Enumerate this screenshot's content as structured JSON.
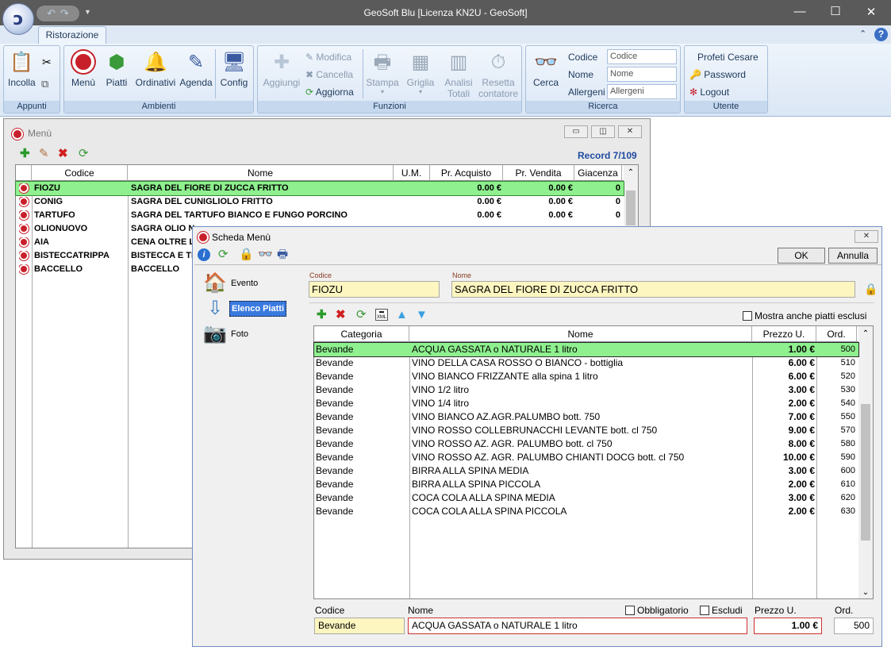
{
  "app": {
    "title": "GeoSoft Blu   [Licenza KN2U - GeoSoft]",
    "orb_letter": "ɔ"
  },
  "ribbon": {
    "tab": "Ristorazione",
    "groups": {
      "appunti": "Appunti",
      "ambienti": "Ambienti",
      "funzioni": "Funzioni",
      "ricerca": "Ricerca",
      "utente": "Utente"
    },
    "buttons": {
      "incolla": "Incolla",
      "menu": "Menù",
      "piatti": "Piatti",
      "ordinativi": "Ordinativi",
      "agenda": "Agenda",
      "config": "Config",
      "aggiungi": "Aggiungi",
      "modifica": "Modifica",
      "cancella": "Cancella",
      "aggiorna": "Aggiorna",
      "stampa": "Stampa",
      "griglia": "Griglia",
      "analisi": "Analisi",
      "totali": "Totali",
      "resetta": "Resetta",
      "contatore": "contatore",
      "cerca": "Cerca"
    },
    "search": {
      "codice_label": "Codice",
      "codice_placeholder": "Codice",
      "nome_label": "Nome",
      "nome_placeholder": "Nome",
      "allergeni_label": "Allergeni",
      "allergeni_placeholder": "Allergeni"
    },
    "user": {
      "name": "Profeti Cesare",
      "password": "Password",
      "logout": "Logout"
    }
  },
  "menu_window": {
    "title": "Menù",
    "record": "Record 7/109",
    "columns": [
      "Codice",
      "Nome",
      "U.M.",
      "Pr. Acquisto",
      "Pr. Vendita",
      "Giacenza"
    ],
    "rows": [
      {
        "codice": "FIOZU",
        "nome": "SAGRA DEL FIORE DI ZUCCA FRITTO",
        "acq": "0.00 €",
        "ven": "0.00 €",
        "gia": "0"
      },
      {
        "codice": "CONIG",
        "nome": "SAGRA DEL CUNIGLIOLO FRITTO",
        "acq": "0.00 €",
        "ven": "0.00 €",
        "gia": "0"
      },
      {
        "codice": "TARTUFO",
        "nome": "SAGRA DEL TARTUFO BIANCO E FUNGO PORCINO",
        "acq": "0.00 €",
        "ven": "0.00 €",
        "gia": "0"
      },
      {
        "codice": "OLIONUOVO",
        "nome": "SAGRA OLIO N",
        "acq": "",
        "ven": "",
        "gia": ""
      },
      {
        "codice": "AIA",
        "nome": "CENA OLTRE L",
        "acq": "",
        "ven": "",
        "gia": ""
      },
      {
        "codice": "BISTECCATRIPPA",
        "nome": "BISTECCA E TR",
        "acq": "",
        "ven": "",
        "gia": ""
      },
      {
        "codice": "BACCELLO",
        "nome": "BACCELLO",
        "acq": "",
        "ven": "",
        "gia": ""
      }
    ]
  },
  "scheda": {
    "title": "Scheda Menù",
    "ok": "OK",
    "annulla": "Annulla",
    "nav": [
      "Evento",
      "Elenco Piatti",
      "Foto"
    ],
    "codice_label": "Codice",
    "codice_value": "FIOZU",
    "nome_label": "Nome",
    "nome_value": "SAGRA DEL FIORE DI ZUCCA FRITTO",
    "mostra": "Mostra anche piatti esclusi",
    "columns": [
      "Categoria",
      "Nome",
      "Prezzo U.",
      "Ord."
    ],
    "rows": [
      {
        "cat": "Bevande",
        "nome": "ACQUA GASSATA o NATURALE 1 litro",
        "prezzo": "1.00 €",
        "ord": "500"
      },
      {
        "cat": "Bevande",
        "nome": "VINO DELLA CASA ROSSO O BIANCO  - bottiglia",
        "prezzo": "6.00 €",
        "ord": "510"
      },
      {
        "cat": "Bevande",
        "nome": "VINO BIANCO FRIZZANTE alla spina 1 litro",
        "prezzo": "6.00 €",
        "ord": "520"
      },
      {
        "cat": "Bevande",
        "nome": "VINO 1/2 litro",
        "prezzo": "3.00 €",
        "ord": "530"
      },
      {
        "cat": "Bevande",
        "nome": "VINO 1/4 litro",
        "prezzo": "2.00 €",
        "ord": "540"
      },
      {
        "cat": "Bevande",
        "nome": "VINO BIANCO AZ.AGR.PALUMBO bott. 750",
        "prezzo": "7.00 €",
        "ord": "550"
      },
      {
        "cat": "Bevande",
        "nome": "VINO ROSSO COLLEBRUNACCHI LEVANTE  bott. cl 750",
        "prezzo": "9.00 €",
        "ord": "570"
      },
      {
        "cat": "Bevande",
        "nome": "VINO ROSSO AZ. AGR. PALUMBO   bott. cl 750",
        "prezzo": "8.00 €",
        "ord": "580"
      },
      {
        "cat": "Bevande",
        "nome": "VINO ROSSO AZ. AGR. PALUMBO CHIANTI DOCG bott. cl 750",
        "prezzo": "10.00 €",
        "ord": "590"
      },
      {
        "cat": "Bevande",
        "nome": "BIRRA ALLA SPINA MEDIA",
        "prezzo": "3.00 €",
        "ord": "600"
      },
      {
        "cat": "Bevande",
        "nome": "BIRRA ALLA SPINA PICCOLA",
        "prezzo": "2.00 €",
        "ord": "610"
      },
      {
        "cat": "Bevande",
        "nome": "COCA COLA ALLA SPINA MEDIA",
        "prezzo": "3.00 €",
        "ord": "620"
      },
      {
        "cat": "Bevande",
        "nome": "COCA COLA ALLA SPINA PICCOLA",
        "prezzo": "2.00 €",
        "ord": "630"
      }
    ],
    "edit": {
      "codice_label": "Codice",
      "codice_value": "Bevande",
      "nome_label": "Nome",
      "nome_value": "ACQUA GASSATA o NATURALE 1 litro",
      "obbligatorio": "Obbligatorio",
      "escludi": "Escludi",
      "prezzo_label": "Prezzo U.",
      "prezzo_value": "1.00 €",
      "ord_label": "Ord.",
      "ord_value": "500"
    }
  },
  "colors": {
    "selection": "#8ef08e",
    "ribbon_text": "#1e395b",
    "titlebar": "#5a5a5a",
    "field_yellow": "#fdf6c0"
  }
}
